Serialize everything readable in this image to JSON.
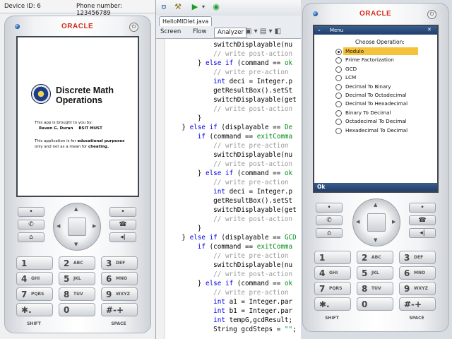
{
  "left_emulator": {
    "device_id_label": "Device ID: 6",
    "phone_number_label": "Phone number: 123456789",
    "brand": "ORACLE",
    "power_glyph": "⏻",
    "splash": {
      "title_line1": "Discrete Math",
      "title_line2": "Operations",
      "brought_by": "This app is brought to you by:",
      "author": "Raven G. Duran",
      "course": "BSIT MUST",
      "note_line1_pre": "This application is for ",
      "note_line1_bold": "educational purposes",
      "note_line2_pre": "only and not as a mean for ",
      "note_line2_bold": "cheating."
    }
  },
  "keypad": {
    "keys": [
      {
        "digit": "1",
        "letters": ""
      },
      {
        "digit": "2",
        "letters": "ABC"
      },
      {
        "digit": "3",
        "letters": "DEF"
      },
      {
        "digit": "4",
        "letters": "GHI"
      },
      {
        "digit": "5",
        "letters": "JKL"
      },
      {
        "digit": "6",
        "letters": "MNO"
      },
      {
        "digit": "7",
        "letters": "PQRS"
      },
      {
        "digit": "8",
        "letters": "TUV"
      },
      {
        "digit": "9",
        "letters": "WXYZ"
      },
      {
        "digit": "✱.",
        "letters": ""
      },
      {
        "digit": "0",
        "letters": ""
      },
      {
        "digit": "#-+",
        "letters": ""
      }
    ],
    "shift_label": "SHIFT",
    "space_label": "SPACE",
    "soft_left_top": "•",
    "soft_right_top": "•",
    "call_glyph": "✆",
    "end_glyph": "☎",
    "home_glyph": "⌂",
    "clear_glyph": "◂|",
    "up": "▲",
    "down": "▼",
    "left": "◀",
    "right": "▶"
  },
  "ide": {
    "file_tab": "HelloMIDlet.java",
    "view_tabs": [
      "Screen",
      "Flow",
      "Analyzer"
    ],
    "toolbar_icons": [
      "ʊ",
      "⚒",
      "▶",
      "▾",
      "◉"
    ],
    "code_lines": [
      {
        "indent": "            ",
        "parts": [
          {
            "t": "switchDisplayable(nu",
            "s": ""
          }
        ]
      },
      {
        "indent": "            ",
        "parts": [
          {
            "t": "// write post-action",
            "s": "c"
          }
        ]
      },
      {
        "indent": "        ",
        "parts": [
          {
            "t": "} ",
            "s": ""
          },
          {
            "t": "else if",
            "s": "k"
          },
          {
            "t": " (command == ",
            "s": ""
          },
          {
            "t": "ok",
            "s": "g"
          }
        ]
      },
      {
        "indent": "            ",
        "parts": [
          {
            "t": "// write pre-action",
            "s": "c"
          }
        ]
      },
      {
        "indent": "            ",
        "parts": [
          {
            "t": "int",
            "s": "k"
          },
          {
            "t": " deci = Integer.p",
            "s": ""
          }
        ]
      },
      {
        "indent": "            ",
        "parts": [
          {
            "t": "getResultBox().setSt",
            "s": ""
          }
        ]
      },
      {
        "indent": "            ",
        "parts": [
          {
            "t": "switchDisplayable(get",
            "s": ""
          }
        ]
      },
      {
        "indent": "            ",
        "parts": [
          {
            "t": "// write post-action",
            "s": "c"
          }
        ]
      },
      {
        "indent": "        ",
        "parts": [
          {
            "t": "}",
            "s": ""
          }
        ]
      },
      {
        "indent": "    ",
        "parts": [
          {
            "t": "} ",
            "s": ""
          },
          {
            "t": "else if",
            "s": "k"
          },
          {
            "t": " (displayable == ",
            "s": ""
          },
          {
            "t": "De",
            "s": "g"
          }
        ]
      },
      {
        "indent": "        ",
        "parts": [
          {
            "t": "if",
            "s": "k"
          },
          {
            "t": " (command == ",
            "s": ""
          },
          {
            "t": "exitComma",
            "s": "g"
          }
        ]
      },
      {
        "indent": "            ",
        "parts": [
          {
            "t": "// write pre-action",
            "s": "c"
          }
        ]
      },
      {
        "indent": "            ",
        "parts": [
          {
            "t": "switchDisplayable(nu",
            "s": ""
          }
        ]
      },
      {
        "indent": "            ",
        "parts": [
          {
            "t": "// write post-action",
            "s": "c"
          }
        ]
      },
      {
        "indent": "        ",
        "parts": [
          {
            "t": "} ",
            "s": ""
          },
          {
            "t": "else if",
            "s": "k"
          },
          {
            "t": " (command == ",
            "s": ""
          },
          {
            "t": "ok",
            "s": "g"
          }
        ]
      },
      {
        "indent": "            ",
        "parts": [
          {
            "t": "// write pre-action",
            "s": "c"
          }
        ]
      },
      {
        "indent": "            ",
        "parts": [
          {
            "t": "int",
            "s": "k"
          },
          {
            "t": " deci = Integer.p",
            "s": ""
          }
        ]
      },
      {
        "indent": "            ",
        "parts": [
          {
            "t": "getResultBox().setSt",
            "s": ""
          }
        ]
      },
      {
        "indent": "            ",
        "parts": [
          {
            "t": "switchDisplayable(get",
            "s": ""
          }
        ]
      },
      {
        "indent": "            ",
        "parts": [
          {
            "t": "// write post-action",
            "s": "c"
          }
        ]
      },
      {
        "indent": "        ",
        "parts": [
          {
            "t": "}",
            "s": ""
          }
        ]
      },
      {
        "indent": "    ",
        "parts": [
          {
            "t": "} ",
            "s": ""
          },
          {
            "t": "else if",
            "s": "k"
          },
          {
            "t": " (displayable == ",
            "s": ""
          },
          {
            "t": "GCD",
            "s": "g"
          }
        ]
      },
      {
        "indent": "        ",
        "parts": [
          {
            "t": "if",
            "s": "k"
          },
          {
            "t": " (command == ",
            "s": ""
          },
          {
            "t": "exitComma",
            "s": "g"
          }
        ]
      },
      {
        "indent": "            ",
        "parts": [
          {
            "t": "// write pre-action",
            "s": "c"
          }
        ]
      },
      {
        "indent": "            ",
        "parts": [
          {
            "t": "switchDisplayable(nu",
            "s": ""
          }
        ]
      },
      {
        "indent": "            ",
        "parts": [
          {
            "t": "// write post-action",
            "s": "c"
          }
        ]
      },
      {
        "indent": "        ",
        "parts": [
          {
            "t": "} ",
            "s": ""
          },
          {
            "t": "else if",
            "s": "k"
          },
          {
            "t": " (command == ",
            "s": ""
          },
          {
            "t": "ok",
            "s": "g"
          }
        ]
      },
      {
        "indent": "            ",
        "parts": [
          {
            "t": "// write pre-action",
            "s": "c"
          }
        ]
      },
      {
        "indent": "            ",
        "parts": [
          {
            "t": "int",
            "s": "k"
          },
          {
            "t": " a1 = Integer.par",
            "s": ""
          }
        ]
      },
      {
        "indent": "            ",
        "parts": [
          {
            "t": "int",
            "s": "k"
          },
          {
            "t": " b1 = Integer.par",
            "s": ""
          }
        ]
      },
      {
        "indent": "            ",
        "parts": [
          {
            "t": "int",
            "s": "k"
          },
          {
            "t": " tempG,gcdResult;",
            "s": ""
          }
        ]
      },
      {
        "indent": "            ",
        "parts": [
          {
            "t": "String gcdSteps = ",
            "s": ""
          },
          {
            "t": "\"\"",
            "s": "g"
          },
          {
            "t": ";",
            "s": ""
          }
        ]
      }
    ]
  },
  "right_emulator": {
    "brand": "ORACLE",
    "menu_title": "Menu",
    "choose_label": "Choose Operation:",
    "options": [
      "Modulo",
      "Prime Factorization",
      "GCD",
      "LCM",
      "Decimal To Binary",
      "Decimal To Octadecimal",
      "Decimal To Hexadecimal",
      "Binary To Decimal",
      "Octadecimal To Decimal",
      "Hexadecimal To Decimal"
    ],
    "selected_index": 0,
    "ok_label": "Ok",
    "close_glyph": "✕",
    "menu_glyph": "⌄"
  },
  "colors": {
    "brand_red": "#d42b1e",
    "menu_bar": "#1f3e6d",
    "highlight": "#f6c23a",
    "keyword": "#0000e6",
    "comment": "#9a9a9a"
  }
}
